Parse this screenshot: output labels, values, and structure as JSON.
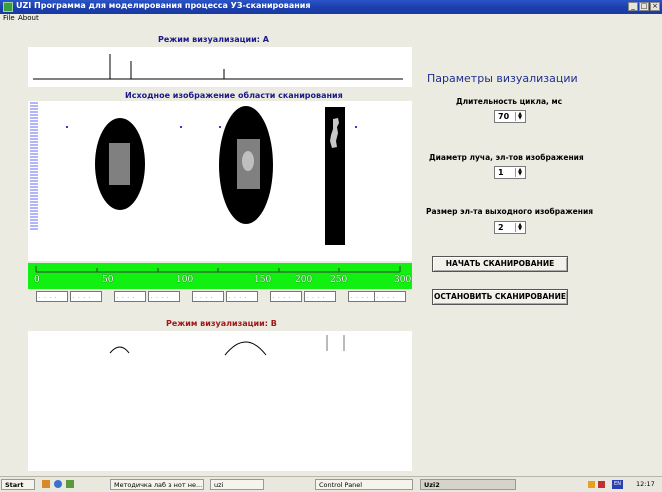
{
  "window": {
    "title": "UZI  Программа для моделирования процесса УЗ-сканирования",
    "min": "_",
    "max": "□",
    "close": "×"
  },
  "menu": [
    {
      "label": "File"
    },
    {
      "label": "About"
    }
  ],
  "mode_a": {
    "label": "Режим визуализации: A"
  },
  "source": {
    "label": "Исходное изображение области сканирования"
  },
  "ruler": {
    "ticks": [
      "0",
      "50",
      "100",
      "150",
      "200",
      "250",
      "300"
    ]
  },
  "mode_b": {
    "label": "Режим визуализации: B"
  },
  "params": {
    "heading": "Параметры визуализации",
    "cycle_label": "Длительность цикла, мс",
    "cycle_value": "70",
    "beam_label": "Диаметр луча, эл-тов изображения",
    "beam_value": "1",
    "out_label": "Размер эл-та выходного изображения",
    "out_value": "2",
    "start_button": "НАЧАТЬ СКАНИРОВАНИЕ",
    "stop_button": "ОСТАНОВИТЬ СКАНИРОВАНИЕ"
  },
  "taskbar": {
    "start": "Start",
    "items": [
      "Методичка лаб з нот не...",
      "uzi",
      "Control Panel",
      "Uzi2"
    ],
    "clock": "12:17",
    "lang": "EN"
  }
}
